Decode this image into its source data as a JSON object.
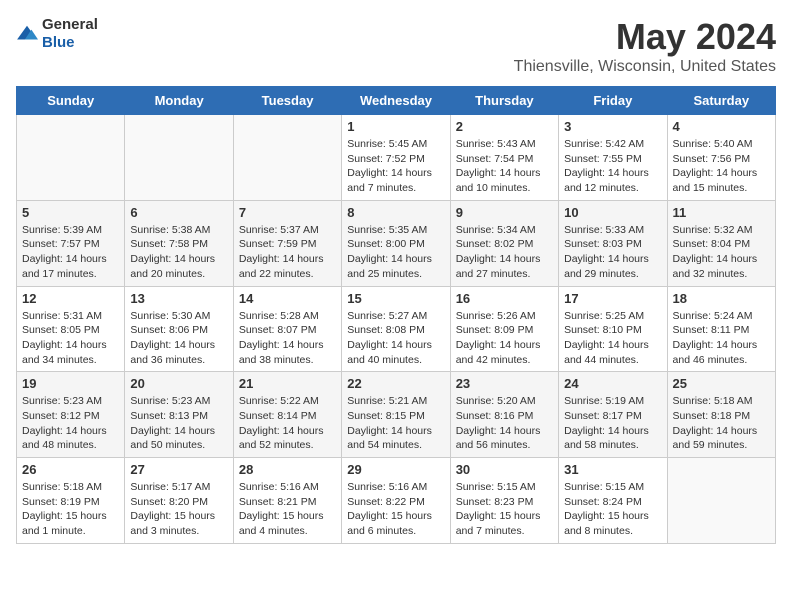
{
  "header": {
    "logo_general": "General",
    "logo_blue": "Blue",
    "title": "May 2024",
    "subtitle": "Thiensville, Wisconsin, United States"
  },
  "days_of_week": [
    "Sunday",
    "Monday",
    "Tuesday",
    "Wednesday",
    "Thursday",
    "Friday",
    "Saturday"
  ],
  "weeks": [
    [
      {
        "day": "",
        "info": ""
      },
      {
        "day": "",
        "info": ""
      },
      {
        "day": "",
        "info": ""
      },
      {
        "day": "1",
        "info": "Sunrise: 5:45 AM\nSunset: 7:52 PM\nDaylight: 14 hours\nand 7 minutes."
      },
      {
        "day": "2",
        "info": "Sunrise: 5:43 AM\nSunset: 7:54 PM\nDaylight: 14 hours\nand 10 minutes."
      },
      {
        "day": "3",
        "info": "Sunrise: 5:42 AM\nSunset: 7:55 PM\nDaylight: 14 hours\nand 12 minutes."
      },
      {
        "day": "4",
        "info": "Sunrise: 5:40 AM\nSunset: 7:56 PM\nDaylight: 14 hours\nand 15 minutes."
      }
    ],
    [
      {
        "day": "5",
        "info": "Sunrise: 5:39 AM\nSunset: 7:57 PM\nDaylight: 14 hours\nand 17 minutes."
      },
      {
        "day": "6",
        "info": "Sunrise: 5:38 AM\nSunset: 7:58 PM\nDaylight: 14 hours\nand 20 minutes."
      },
      {
        "day": "7",
        "info": "Sunrise: 5:37 AM\nSunset: 7:59 PM\nDaylight: 14 hours\nand 22 minutes."
      },
      {
        "day": "8",
        "info": "Sunrise: 5:35 AM\nSunset: 8:00 PM\nDaylight: 14 hours\nand 25 minutes."
      },
      {
        "day": "9",
        "info": "Sunrise: 5:34 AM\nSunset: 8:02 PM\nDaylight: 14 hours\nand 27 minutes."
      },
      {
        "day": "10",
        "info": "Sunrise: 5:33 AM\nSunset: 8:03 PM\nDaylight: 14 hours\nand 29 minutes."
      },
      {
        "day": "11",
        "info": "Sunrise: 5:32 AM\nSunset: 8:04 PM\nDaylight: 14 hours\nand 32 minutes."
      }
    ],
    [
      {
        "day": "12",
        "info": "Sunrise: 5:31 AM\nSunset: 8:05 PM\nDaylight: 14 hours\nand 34 minutes."
      },
      {
        "day": "13",
        "info": "Sunrise: 5:30 AM\nSunset: 8:06 PM\nDaylight: 14 hours\nand 36 minutes."
      },
      {
        "day": "14",
        "info": "Sunrise: 5:28 AM\nSunset: 8:07 PM\nDaylight: 14 hours\nand 38 minutes."
      },
      {
        "day": "15",
        "info": "Sunrise: 5:27 AM\nSunset: 8:08 PM\nDaylight: 14 hours\nand 40 minutes."
      },
      {
        "day": "16",
        "info": "Sunrise: 5:26 AM\nSunset: 8:09 PM\nDaylight: 14 hours\nand 42 minutes."
      },
      {
        "day": "17",
        "info": "Sunrise: 5:25 AM\nSunset: 8:10 PM\nDaylight: 14 hours\nand 44 minutes."
      },
      {
        "day": "18",
        "info": "Sunrise: 5:24 AM\nSunset: 8:11 PM\nDaylight: 14 hours\nand 46 minutes."
      }
    ],
    [
      {
        "day": "19",
        "info": "Sunrise: 5:23 AM\nSunset: 8:12 PM\nDaylight: 14 hours\nand 48 minutes."
      },
      {
        "day": "20",
        "info": "Sunrise: 5:23 AM\nSunset: 8:13 PM\nDaylight: 14 hours\nand 50 minutes."
      },
      {
        "day": "21",
        "info": "Sunrise: 5:22 AM\nSunset: 8:14 PM\nDaylight: 14 hours\nand 52 minutes."
      },
      {
        "day": "22",
        "info": "Sunrise: 5:21 AM\nSunset: 8:15 PM\nDaylight: 14 hours\nand 54 minutes."
      },
      {
        "day": "23",
        "info": "Sunrise: 5:20 AM\nSunset: 8:16 PM\nDaylight: 14 hours\nand 56 minutes."
      },
      {
        "day": "24",
        "info": "Sunrise: 5:19 AM\nSunset: 8:17 PM\nDaylight: 14 hours\nand 58 minutes."
      },
      {
        "day": "25",
        "info": "Sunrise: 5:18 AM\nSunset: 8:18 PM\nDaylight: 14 hours\nand 59 minutes."
      }
    ],
    [
      {
        "day": "26",
        "info": "Sunrise: 5:18 AM\nSunset: 8:19 PM\nDaylight: 15 hours\nand 1 minute."
      },
      {
        "day": "27",
        "info": "Sunrise: 5:17 AM\nSunset: 8:20 PM\nDaylight: 15 hours\nand 3 minutes."
      },
      {
        "day": "28",
        "info": "Sunrise: 5:16 AM\nSunset: 8:21 PM\nDaylight: 15 hours\nand 4 minutes."
      },
      {
        "day": "29",
        "info": "Sunrise: 5:16 AM\nSunset: 8:22 PM\nDaylight: 15 hours\nand 6 minutes."
      },
      {
        "day": "30",
        "info": "Sunrise: 5:15 AM\nSunset: 8:23 PM\nDaylight: 15 hours\nand 7 minutes."
      },
      {
        "day": "31",
        "info": "Sunrise: 5:15 AM\nSunset: 8:24 PM\nDaylight: 15 hours\nand 8 minutes."
      },
      {
        "day": "",
        "info": ""
      }
    ]
  ]
}
